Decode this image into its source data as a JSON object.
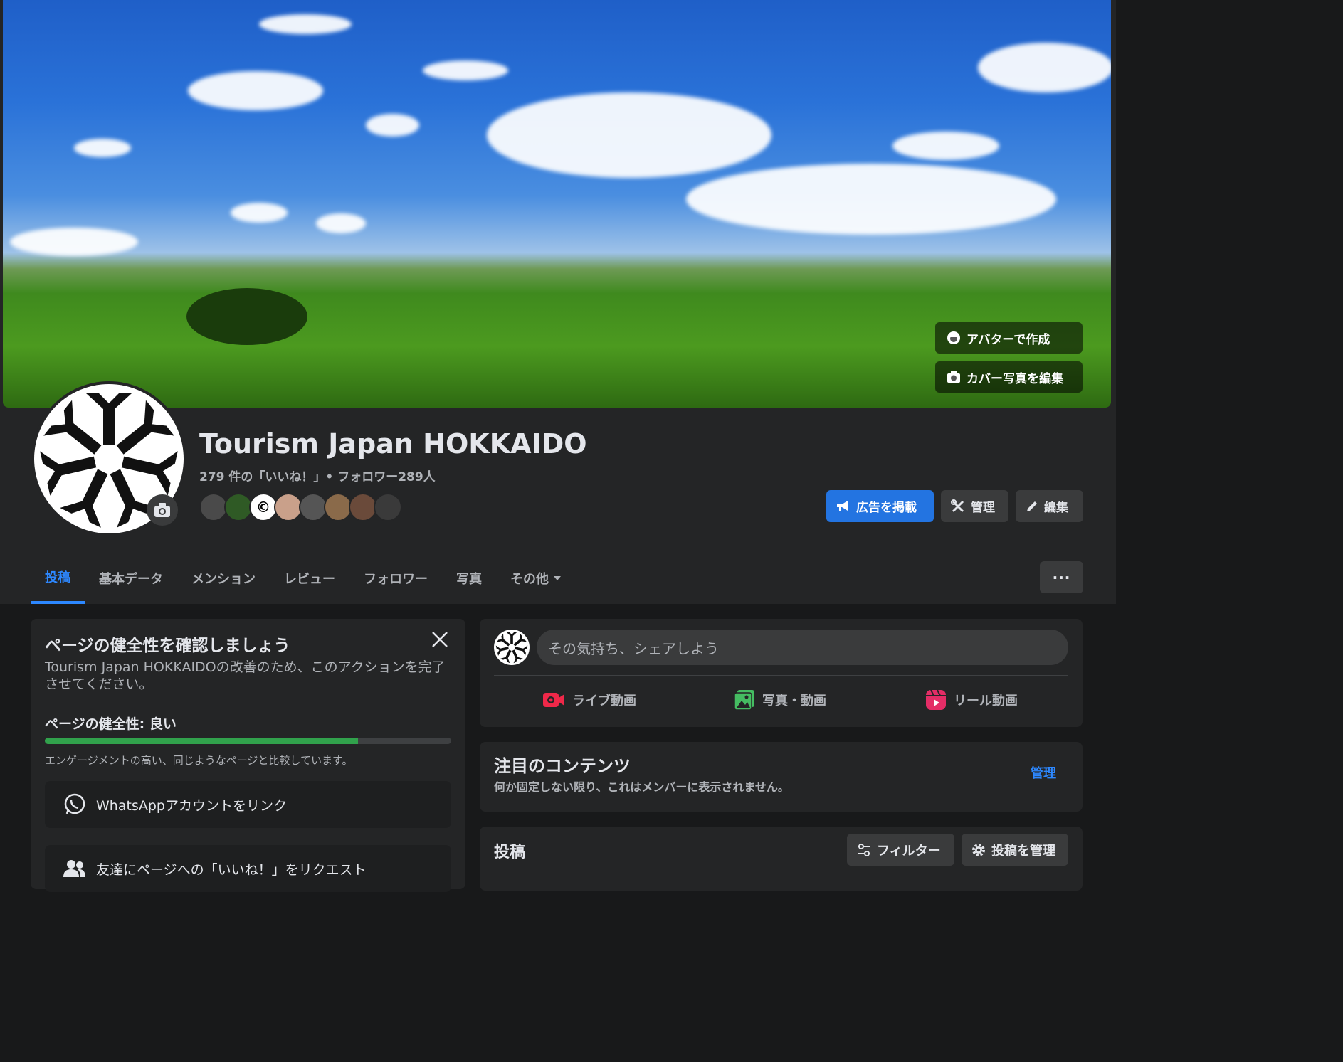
{
  "cover": {
    "avatar_create_label": "アバターで作成",
    "edit_cover_label": "カバー写真を編集"
  },
  "profile": {
    "name": "Tourism Japan HOKKAIDO",
    "stats": "279 件の「いいね！」• フォロワー289人"
  },
  "actions": {
    "advertise_label": "広告を掲載",
    "manage_label": "管理",
    "edit_label": "編集"
  },
  "tabs": [
    {
      "label": "投稿"
    },
    {
      "label": "基本データ"
    },
    {
      "label": "メンション"
    },
    {
      "label": "レビュー"
    },
    {
      "label": "フォロワー"
    },
    {
      "label": "写真"
    },
    {
      "label": "その他"
    }
  ],
  "more_button": "···",
  "health": {
    "title": "ページの健全性を確認しましょう",
    "description": "Tourism Japan HOKKAIDOの改善のため、このアクションを完了させてください。",
    "status": "ページの健全性: 良い",
    "progress": 0.77,
    "note": "エンゲージメントの高い、同じようなページと比較しています。",
    "tasks": [
      {
        "label": "WhatsAppアカウントをリンク"
      },
      {
        "label": "友達にページへの「いいね！」をリクエスト"
      }
    ]
  },
  "composer": {
    "placeholder": "その気持ち、シェアしよう",
    "live_label": "ライブ動画",
    "photo_label": "写真・動画",
    "reel_label": "リール動画"
  },
  "featured": {
    "title": "注目のコンテンツ",
    "subtitle": "何か固定しない限り、これはメンバーに表示されません。",
    "manage_label": "管理"
  },
  "posts": {
    "title": "投稿",
    "filter_label": "フィルター",
    "manage_label": "投稿を管理"
  },
  "colors": {
    "accent": "#2d88ff",
    "primary_button": "#2374e1",
    "health_good": "#31a24c",
    "live_icon": "#f02849",
    "photo_icon": "#45bd62",
    "reel_icon": "#e42d66"
  }
}
